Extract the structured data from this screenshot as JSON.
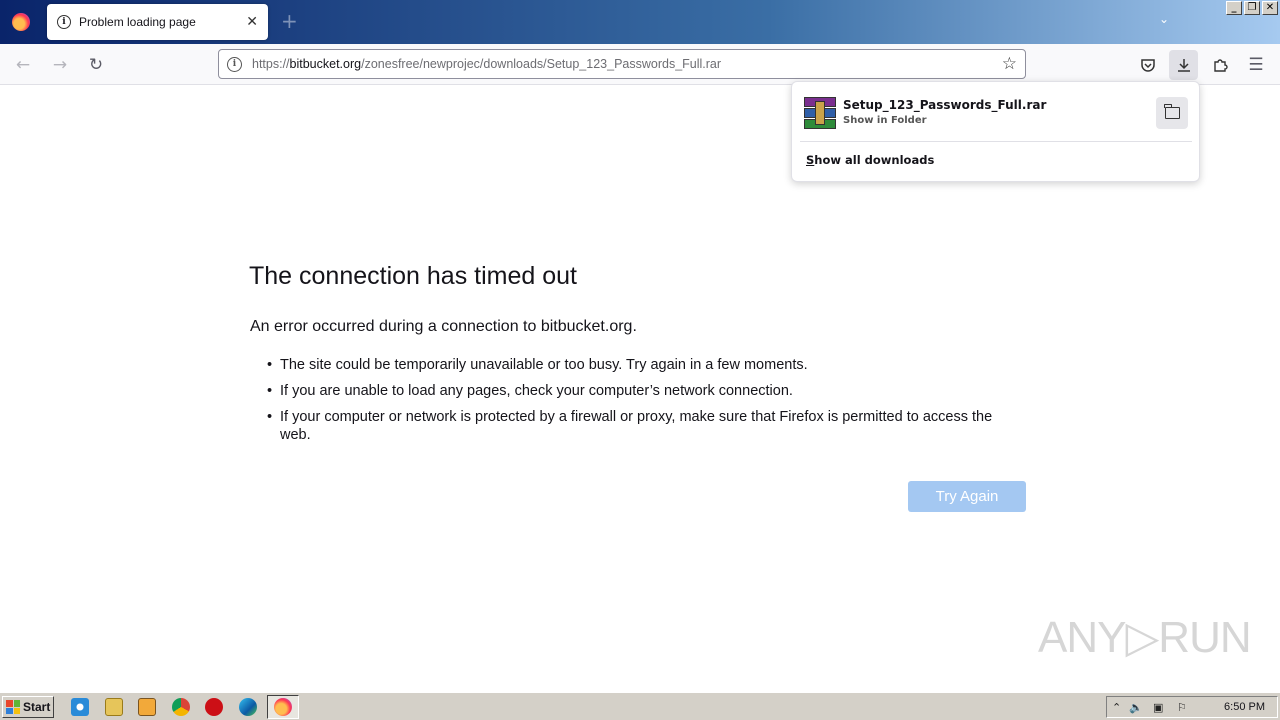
{
  "browser": {
    "tab": {
      "title": "Problem loading page",
      "close": "✕"
    },
    "new_tab": "+",
    "url": {
      "scheme": "https://",
      "host": "bitbucket.org",
      "path": "/zonesfree/newprojec/downloads/Setup_123_Passwords_Full.rar"
    }
  },
  "downloads": {
    "item": {
      "filename": "Setup_123_Passwords_Full.rar",
      "action": "Show in Folder"
    },
    "show_all_first": "S",
    "show_all_rest": "how all downloads"
  },
  "error": {
    "title": "The connection has timed out",
    "description": "An error occurred during a connection to bitbucket.org.",
    "bullets": [
      "The site could be temporarily unavailable or too busy. Try again in a few moments.",
      "If you are unable to load any pages, check your computer’s network connection.",
      "If your computer or network is protected by a firewall or proxy, make sure that Firefox is permitted to access the web."
    ],
    "button": "Try Again"
  },
  "watermark": "ANY▷RUN",
  "taskbar": {
    "start": "Start",
    "clock": "6:50 PM"
  },
  "colors": {
    "accent": "#0060df",
    "try_again_bg": "#a4c8f2"
  }
}
